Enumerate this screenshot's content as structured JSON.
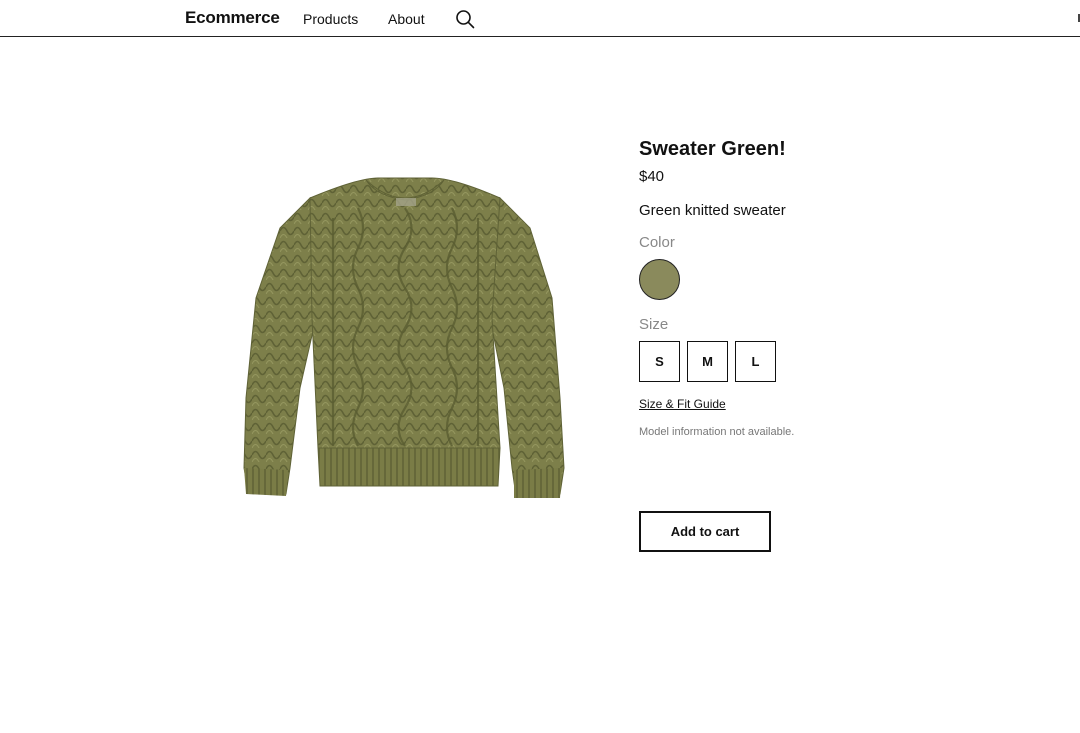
{
  "header": {
    "brand": "Ecommerce",
    "nav": [
      {
        "label": "Products"
      },
      {
        "label": "About"
      }
    ],
    "search_icon": "search-icon"
  },
  "product": {
    "title": "Sweater Green!",
    "price": "$40",
    "description": "Green knitted sweater",
    "image": "green-cable-knit-sweater",
    "color_label": "Color",
    "colors": [
      {
        "name": "Green",
        "hex": "#8a8a5c"
      }
    ],
    "size_label": "Size",
    "sizes": [
      "S",
      "M",
      "L"
    ],
    "size_guide_link": "Size & Fit Guide",
    "model_info": "Model information not available.",
    "add_to_cart": "Add to cart"
  },
  "colors": {
    "sweater": "#7d7f4a",
    "sweater_shadow": "#5f6236",
    "sweater_highlight": "#95975f"
  }
}
